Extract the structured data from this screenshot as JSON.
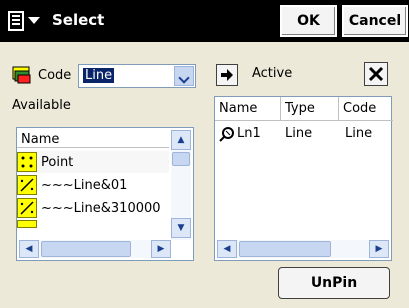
{
  "title_bar": {
    "title": "Select",
    "ok_label": "OK",
    "cancel_label": "Cancel"
  },
  "filter": {
    "code_label": "Code",
    "code_value": "Line",
    "available_label": "Available",
    "active_label": "Active"
  },
  "available_list": {
    "column_header": "Name",
    "items": [
      "Point",
      "~~~Line&01",
      "~~~Line&310000"
    ]
  },
  "active_list": {
    "columns": [
      "Name",
      "Type",
      "Code"
    ],
    "rows": [
      {
        "name": "Ln1",
        "type": "Line",
        "code": "Line"
      }
    ]
  },
  "buttons": {
    "unpin_label": "UnPin"
  },
  "colors": {
    "title_bar": "#000000",
    "background": "#ece9d8",
    "selection": "#0a246a",
    "code_icon": "#ffff00"
  }
}
